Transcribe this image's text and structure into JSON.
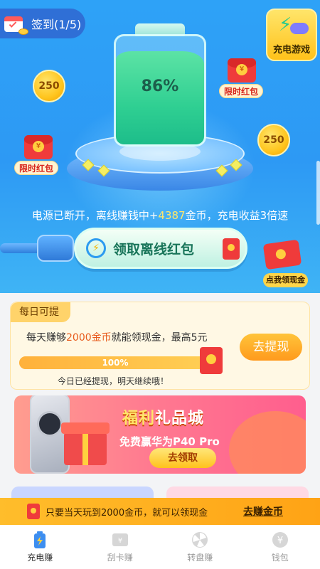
{
  "signin": {
    "label": "签到(1/5)",
    "icon": "calendar-icon"
  },
  "game_button": {
    "label": "充电游戏",
    "icon": "gamepad-bolt-icon"
  },
  "battery": {
    "percent_label": "86%",
    "level": 0.86
  },
  "coins": [
    {
      "value": "250"
    },
    {
      "value": "250"
    }
  ],
  "limited_envelopes": [
    {
      "label": "限时红包"
    },
    {
      "label": "限时红包"
    }
  ],
  "offline": {
    "text_before": "电源已断开，离线赚钱中+",
    "amount": "4387",
    "text_after": "金币，充电收益3倍速"
  },
  "claim_button": {
    "label": "领取离线红包"
  },
  "cash_envelope": {
    "label": "点我领现金"
  },
  "daily": {
    "tag": "每日可提",
    "line_before": "每天赚够",
    "line_highlight": "2000金币",
    "line_after": "就能领现金，最高5元",
    "progress_label": "100%",
    "progress_value": 1.0,
    "sub": "今日已经提现，明天继续哦！",
    "button": "去提现"
  },
  "banner": {
    "title_gold": "福利",
    "title_white": "礼品城",
    "subtitle": "免费赢华为P40 Pro",
    "button": "去领取"
  },
  "notice": {
    "text": "只要当天玩到2000金币，就可以领现金",
    "link": "去赚金币"
  },
  "tabs": [
    {
      "label": "充电赚",
      "icon": "battery-icon",
      "active": true
    },
    {
      "label": "刮卡赚",
      "icon": "scratch-card-icon",
      "active": false
    },
    {
      "label": "转盘赚",
      "icon": "wheel-icon",
      "active": false
    },
    {
      "label": "钱包",
      "icon": "wallet-icon",
      "active": false
    }
  ],
  "colors": {
    "hero_blue": "#2ea2f7",
    "battery_green": "#2fcf92",
    "accent_orange": "#ffa315",
    "highlight_yellow": "#ffe76a"
  }
}
